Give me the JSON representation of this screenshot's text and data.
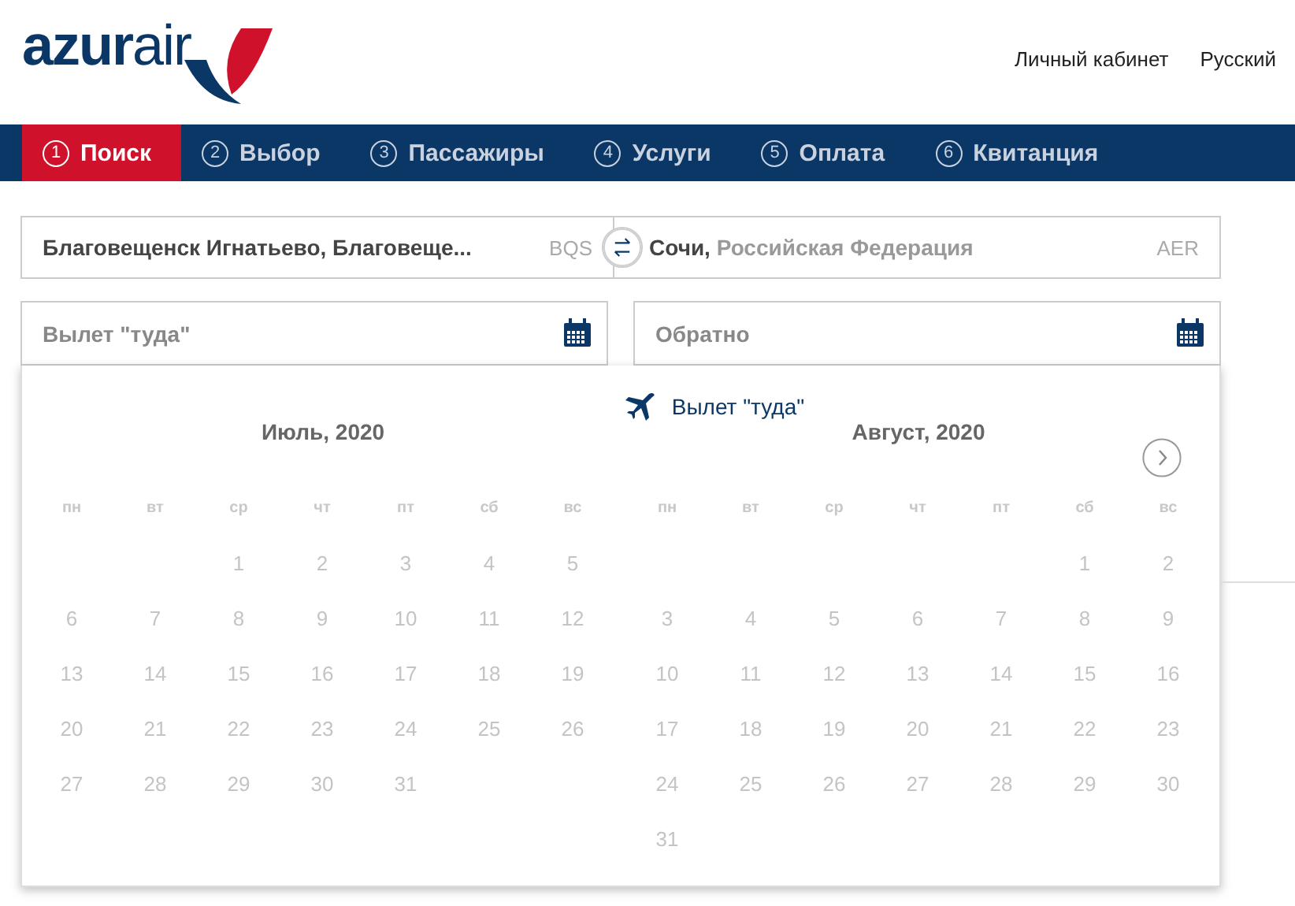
{
  "logo": {
    "part_1": "azur",
    "part_2": "air"
  },
  "header_links": [
    "Личный кабинет",
    "Русский"
  ],
  "steps": [
    {
      "number": "1",
      "label": "Поиск",
      "selected": true
    },
    {
      "number": "2",
      "label": "Выбор",
      "selected": false
    },
    {
      "number": "3",
      "label": "Пассажиры",
      "selected": false
    },
    {
      "number": "4",
      "label": "Услуги",
      "selected": false
    },
    {
      "number": "5",
      "label": "Оплата",
      "selected": false
    },
    {
      "number": "6",
      "label": "Квитанция",
      "selected": false
    }
  ],
  "route": {
    "from": {
      "city": "Благовещенск Игнатьево, Благовеще...",
      "code": "BQS"
    },
    "to": {
      "city": "Сочи,",
      "country": "Российская Федерация",
      "code": "AER"
    }
  },
  "dates": [
    {
      "placeholder": "Вылет \"туда\""
    },
    {
      "placeholder": "Обратно"
    }
  ],
  "calendar": {
    "title": "Вылет \"туда\"",
    "months": [
      {
        "title": "Июль, 2020",
        "weekdays": [
          "пн",
          "вт",
          "ср",
          "чт",
          "пт",
          "сб",
          "вс"
        ],
        "cells": [
          {
            "kind": "blank"
          },
          {
            "kind": "blank"
          },
          {
            "kind": "day",
            "label": "1"
          },
          {
            "kind": "day",
            "label": "2"
          },
          {
            "kind": "day",
            "label": "3"
          },
          {
            "kind": "day",
            "label": "4"
          },
          {
            "kind": "day",
            "label": "5"
          },
          {
            "kind": "day",
            "label": "6"
          },
          {
            "kind": "day",
            "label": "7"
          },
          {
            "kind": "day",
            "label": "8"
          },
          {
            "kind": "day",
            "label": "9"
          },
          {
            "kind": "day",
            "label": "10"
          },
          {
            "kind": "day",
            "label": "11"
          },
          {
            "kind": "day",
            "label": "12"
          },
          {
            "kind": "day",
            "label": "13"
          },
          {
            "kind": "day",
            "label": "14"
          },
          {
            "kind": "day",
            "label": "15"
          },
          {
            "kind": "day",
            "label": "16"
          },
          {
            "kind": "day",
            "label": "17"
          },
          {
            "kind": "day",
            "label": "18"
          },
          {
            "kind": "day",
            "label": "19"
          },
          {
            "kind": "day",
            "label": "20"
          },
          {
            "kind": "day",
            "label": "21"
          },
          {
            "kind": "day",
            "label": "22"
          },
          {
            "kind": "day",
            "label": "23"
          },
          {
            "kind": "day",
            "label": "24"
          },
          {
            "kind": "day",
            "label": "25"
          },
          {
            "kind": "day",
            "label": "26"
          },
          {
            "kind": "day",
            "label": "27"
          },
          {
            "kind": "day",
            "label": "28"
          },
          {
            "kind": "day",
            "label": "29"
          },
          {
            "kind": "day",
            "label": "30"
          },
          {
            "kind": "day",
            "label": "31"
          }
        ]
      },
      {
        "title": "Август, 2020",
        "weekdays": [
          "пн",
          "вт",
          "ср",
          "чт",
          "пт",
          "сб",
          "вс"
        ],
        "cells": [
          {
            "kind": "blank"
          },
          {
            "kind": "blank"
          },
          {
            "kind": "blank"
          },
          {
            "kind": "blank"
          },
          {
            "kind": "blank"
          },
          {
            "kind": "day",
            "label": "1"
          },
          {
            "kind": "day",
            "label": "2"
          },
          {
            "kind": "day",
            "label": "3"
          },
          {
            "kind": "day",
            "label": "4"
          },
          {
            "kind": "day",
            "label": "5"
          },
          {
            "kind": "day",
            "label": "6"
          },
          {
            "kind": "day",
            "label": "7"
          },
          {
            "kind": "day",
            "label": "8"
          },
          {
            "kind": "day",
            "label": "9"
          },
          {
            "kind": "day",
            "label": "10"
          },
          {
            "kind": "day",
            "label": "11"
          },
          {
            "kind": "day",
            "label": "12"
          },
          {
            "kind": "day",
            "label": "13"
          },
          {
            "kind": "day",
            "label": "14"
          },
          {
            "kind": "day",
            "label": "15"
          },
          {
            "kind": "day",
            "label": "16"
          },
          {
            "kind": "day",
            "label": "17"
          },
          {
            "kind": "day",
            "label": "18"
          },
          {
            "kind": "day",
            "label": "19"
          },
          {
            "kind": "day",
            "label": "20"
          },
          {
            "kind": "day",
            "label": "21"
          },
          {
            "kind": "day",
            "label": "22"
          },
          {
            "kind": "day",
            "label": "23"
          },
          {
            "kind": "day",
            "label": "24"
          },
          {
            "kind": "day",
            "label": "25"
          },
          {
            "kind": "day",
            "label": "26"
          },
          {
            "kind": "day",
            "label": "27"
          },
          {
            "kind": "day",
            "label": "28"
          },
          {
            "kind": "day",
            "label": "29"
          },
          {
            "kind": "day",
            "label": "30"
          },
          {
            "kind": "day",
            "label": "31"
          }
        ]
      }
    ]
  }
}
